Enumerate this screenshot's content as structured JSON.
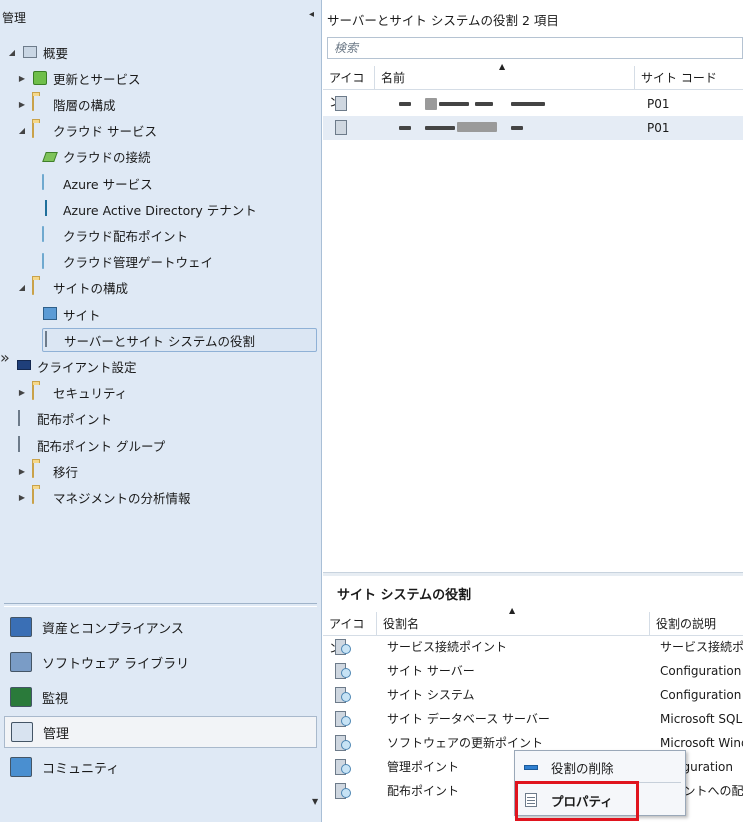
{
  "left_pane": {
    "title": "管理",
    "tree": [
      {
        "label": "概要",
        "level": 0,
        "expander": "expanded",
        "icon": "overview-icon"
      },
      {
        "label": "更新とサービス",
        "level": 1,
        "expander": "collapsed",
        "icon": "updates-icon"
      },
      {
        "label": "階層の構成",
        "level": 1,
        "expander": "collapsed",
        "icon": "folder-icon"
      },
      {
        "label": "クラウド サービス",
        "level": 1,
        "expander": "expanded",
        "icon": "folder-icon"
      },
      {
        "label": "クラウドの接続",
        "level": 2,
        "expander": "none",
        "icon": "cloud-connection-icon"
      },
      {
        "label": "Azure サービス",
        "level": 2,
        "expander": "none",
        "icon": "cloud-icon"
      },
      {
        "label": "Azure Active Directory テナント",
        "level": 2,
        "expander": "none",
        "icon": "azure-ad-icon"
      },
      {
        "label": "クラウド配布ポイント",
        "level": 2,
        "expander": "none",
        "icon": "cloud-icon"
      },
      {
        "label": "クラウド管理ゲートウェイ",
        "level": 2,
        "expander": "none",
        "icon": "cloud-icon"
      },
      {
        "label": "サイトの構成",
        "level": 1,
        "expander": "expanded",
        "icon": "folder-icon"
      },
      {
        "label": "サイト",
        "level": 2,
        "expander": "none",
        "icon": "site-icon"
      },
      {
        "label": "サーバーとサイト システムの役割",
        "level": 2,
        "expander": "none",
        "icon": "server-role-icon",
        "selected": true
      },
      {
        "label": "クライアント設定",
        "level": 1,
        "expander": "none",
        "icon": "client-settings-icon"
      },
      {
        "label": "セキュリティ",
        "level": 1,
        "expander": "collapsed",
        "icon": "folder-icon"
      },
      {
        "label": "配布ポイント",
        "level": 1,
        "expander": "none",
        "icon": "distribution-point-icon"
      },
      {
        "label": "配布ポイント グループ",
        "level": 1,
        "expander": "none",
        "icon": "distribution-point-group-icon"
      },
      {
        "label": "移行",
        "level": 1,
        "expander": "collapsed",
        "icon": "folder-icon"
      },
      {
        "label": "マネジメントの分析情報",
        "level": 1,
        "expander": "collapsed",
        "icon": "folder-icon"
      }
    ],
    "wunderbar": [
      {
        "label": "資産とコンプライアンス",
        "icon": "assets-compliance-icon"
      },
      {
        "label": "ソフトウェア ライブラリ",
        "icon": "software-library-icon"
      },
      {
        "label": "監視",
        "icon": "monitoring-icon"
      },
      {
        "label": "管理",
        "icon": "administration-icon",
        "active": true
      },
      {
        "label": "コミュニティ",
        "icon": "community-icon"
      }
    ]
  },
  "top_list": {
    "title": "サーバーとサイト システムの役割 2 項目",
    "search_placeholder": "検索",
    "columns": [
      "アイコン",
      "名前",
      "サイト コード"
    ],
    "rows": [
      {
        "name": "",
        "site_code": "P01"
      },
      {
        "name": "",
        "site_code": "P01"
      }
    ]
  },
  "bottom_list": {
    "title": "サイト システムの役割",
    "columns": [
      "アイコン",
      "役割名",
      "役割の説明"
    ],
    "rows": [
      {
        "role": "サービス接続ポイント",
        "description": "サービス接続ポイ"
      },
      {
        "role": "サイト サーバー",
        "description": "Configuration"
      },
      {
        "role": "サイト システム",
        "description": "Configuration"
      },
      {
        "role": "サイト データベース サーバー",
        "description": "Microsoft SQL"
      },
      {
        "role": "ソフトウェアの更新ポイント",
        "description": "Microsoft Wind"
      },
      {
        "role": "管理ポイント",
        "description": "onfiguration"
      },
      {
        "role": "配布ポイント",
        "description": "イアントへの配"
      }
    ]
  },
  "context_menu": {
    "items": [
      {
        "label": "役割の削除",
        "icon": "remove-role-icon"
      },
      {
        "label": "プロパティ",
        "icon": "properties-icon"
      }
    ]
  },
  "colors": {
    "left_pane_bg": "#dfe9f5",
    "selection_bg": "#e5ecf5",
    "highlight_border": "#e0141e"
  }
}
